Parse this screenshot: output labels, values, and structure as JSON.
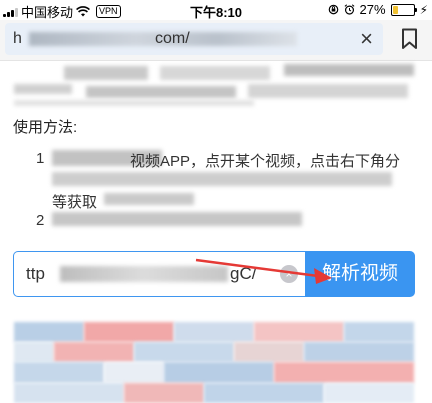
{
  "status_bar": {
    "carrier": "中国移动",
    "vpn_badge": "VPN",
    "time": "下午8:10",
    "battery_percent": "27%",
    "battery_level": 0.27,
    "icons": [
      "signal-icon",
      "wifi-icon",
      "lock-rotation-icon",
      "alarm-icon",
      "battery-icon",
      "charging-bolt-icon"
    ]
  },
  "url_bar": {
    "url_visible_prefix": "h",
    "url_visible_suffix": "com/",
    "clear_glyph": "×",
    "icons": [
      "close-icon",
      "bookmark-icon"
    ]
  },
  "instructions": {
    "heading": "使用方法:",
    "step1_number": "1",
    "step1_fragment": "视频APP，点开某个视频，点击右下角分",
    "step1_line3_fragment": "等获取",
    "step2_number": "2"
  },
  "parse": {
    "input_prefix": "ttp",
    "input_suffix": "gC/",
    "clear_glyph": "×",
    "button_label": "解析视频"
  },
  "colors": {
    "accent": "#3a95f1",
    "arrow": "#e53935",
    "mosaic_red": "#f1a8a8",
    "mosaic_blue": "#b9cfe6"
  }
}
